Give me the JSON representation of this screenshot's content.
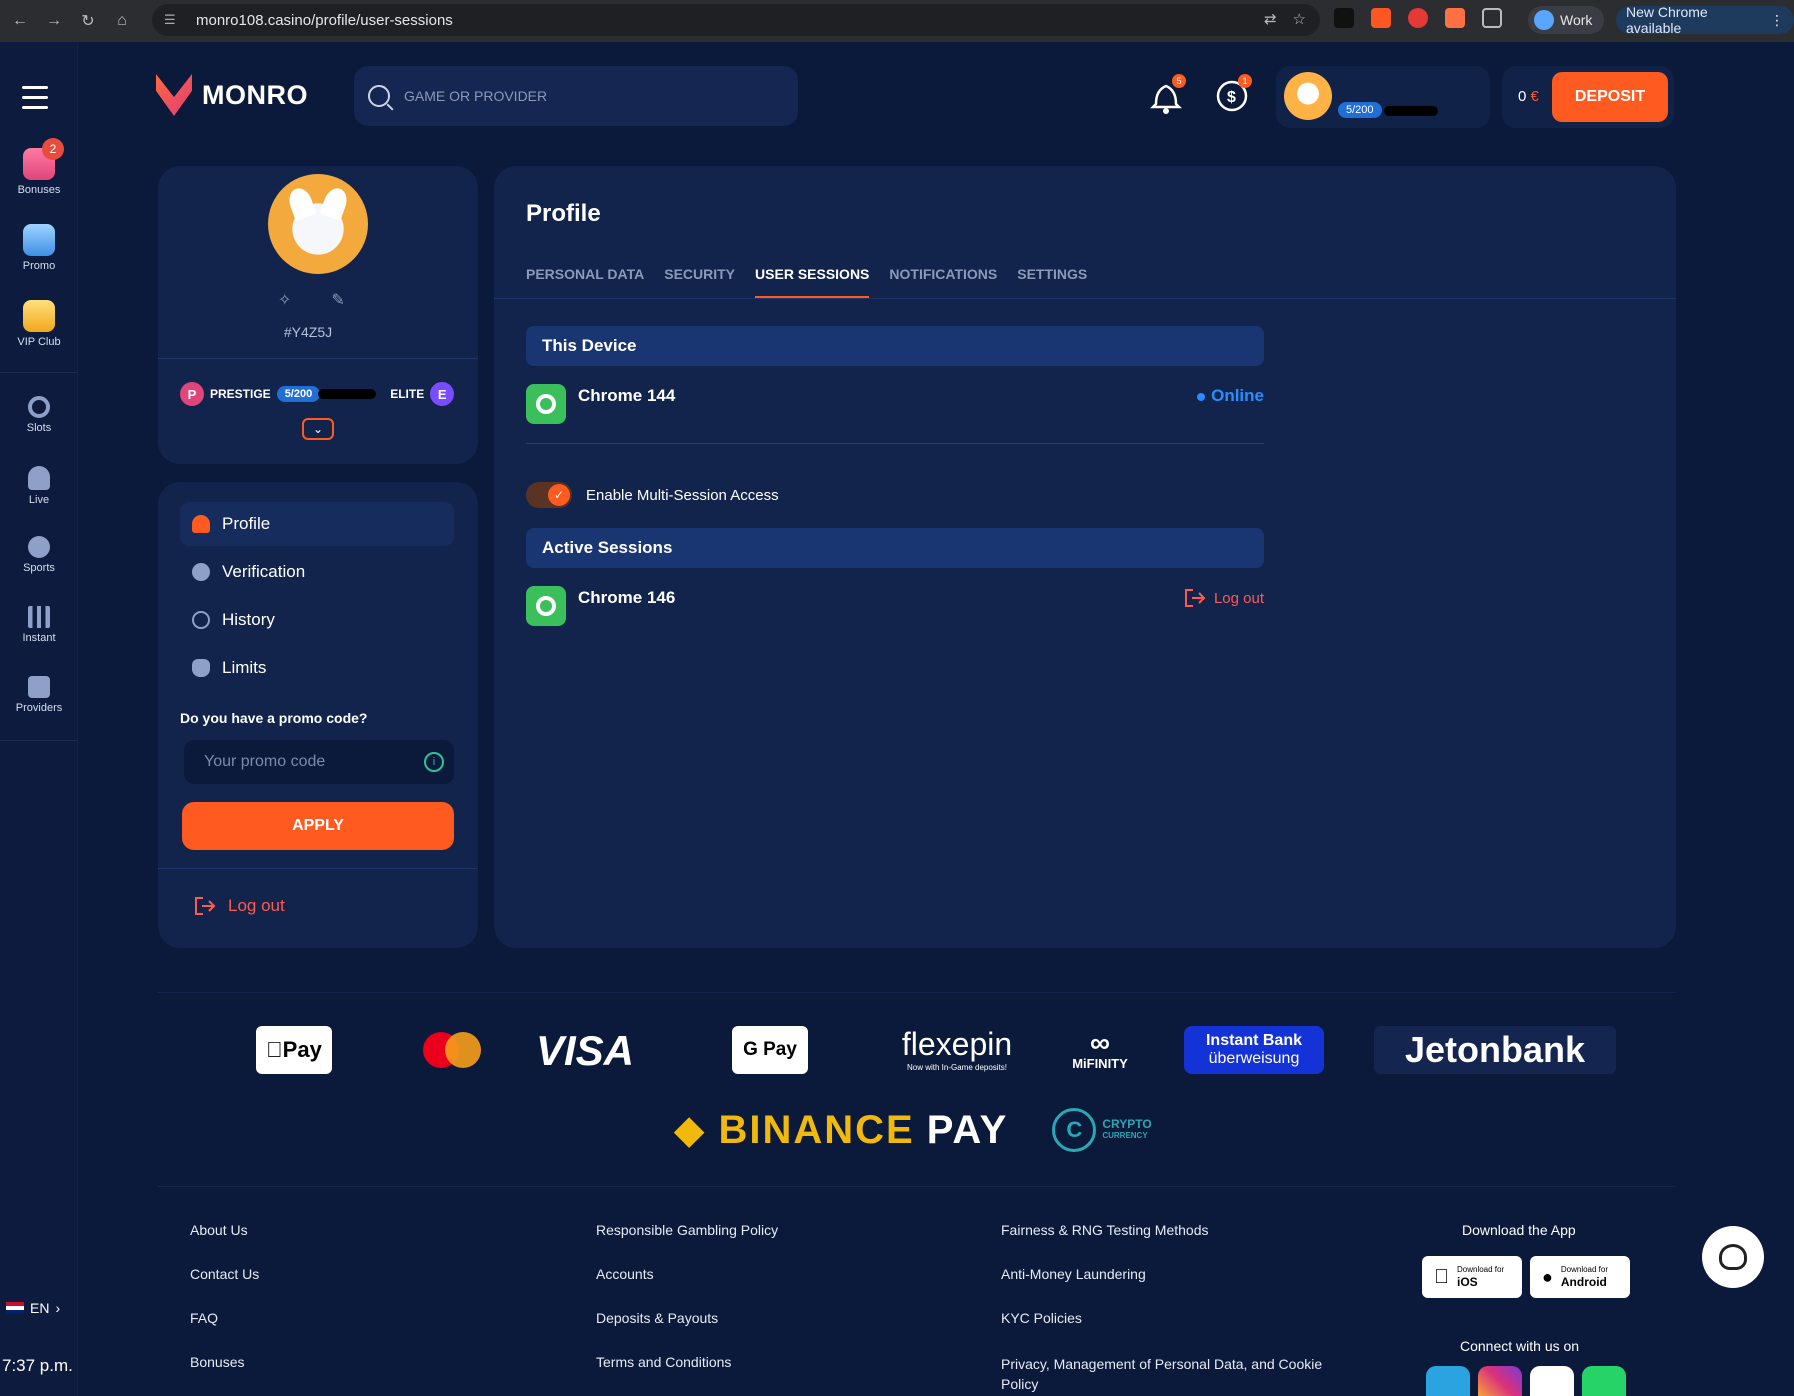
{
  "browser": {
    "url": "monro108.casino/profile/user-sessions",
    "profile_name": "Work",
    "update_label": "New Chrome available"
  },
  "rail": {
    "items": [
      {
        "label": "Bonuses",
        "badge": "2"
      },
      {
        "label": "Promo"
      },
      {
        "label": "VIP Club"
      },
      {
        "label": "Slots"
      },
      {
        "label": "Live"
      },
      {
        "label": "Sports"
      },
      {
        "label": "Instant"
      },
      {
        "label": "Providers"
      }
    ],
    "language": "EN",
    "clock": "7:37 p.m."
  },
  "header": {
    "brand": "MONRO",
    "search_placeholder": "GAME OR PROVIDER",
    "notif_count": "5",
    "cashback_count": "1",
    "level": "5/200",
    "balance_value": "0",
    "balance_currency": "€",
    "deposit_label": "DEPOSIT"
  },
  "profile_card": {
    "user_id": "#Y4Z5J",
    "current_tier_letter": "P",
    "current_tier": "PRESTIGE",
    "progress": "5/200",
    "next_tier": "ELITE",
    "next_tier_letter": "E"
  },
  "menu": {
    "items": [
      {
        "label": "Profile"
      },
      {
        "label": "Verification"
      },
      {
        "label": "History"
      },
      {
        "label": "Limits"
      }
    ],
    "promo_label": "Do you have a promo code?",
    "promo_placeholder": "Your promo code",
    "apply_label": "APPLY",
    "logout_label": "Log out"
  },
  "main": {
    "title": "Profile",
    "tabs": [
      {
        "label": "PERSONAL DATA"
      },
      {
        "label": "SECURITY"
      },
      {
        "label": "USER SESSIONS"
      },
      {
        "label": "NOTIFICATIONS"
      },
      {
        "label": "SETTINGS"
      }
    ],
    "active_tab": "USER SESSIONS",
    "this_device_title": "This Device",
    "this_device": {
      "name": "Chrome 144",
      "status": "Online"
    },
    "multi_session_label": "Enable Multi-Session Access",
    "multi_session_enabled": true,
    "active_sessions_title": "Active Sessions",
    "active_sessions": [
      {
        "name": "Chrome 146",
        "action": "Log out"
      }
    ]
  },
  "payments": {
    "applepay": "Pay",
    "visa": "VISA",
    "gpay": "G Pay",
    "flexepin": "flexepin",
    "flexepin_tag": "Now with In-Game deposits!",
    "mifinity": "MiFINITY",
    "instantbank_1": "Instant Bank",
    "instantbank_2": "überweisung",
    "jetonbank": "Jetonbank",
    "binance": "BINANCE",
    "binance_pay": "PAY",
    "crypto_1": "CRYPTO",
    "crypto_2": "CURRENCY"
  },
  "footer": {
    "col1": [
      "About Us",
      "Contact Us",
      "FAQ",
      "Bonuses"
    ],
    "col2": [
      "Responsible Gambling Policy",
      "Accounts",
      "Deposits & Payouts",
      "Terms and Conditions"
    ],
    "col3": [
      "Fairness & RNG Testing Methods",
      "Anti-Money Laundering",
      "KYC Policies",
      "Privacy, Management of Personal Data, and Cookie Policy"
    ],
    "download_title": "Download the App",
    "ios_small": "Download for",
    "ios_label": "iOS",
    "android_small": "Download for",
    "android_label": "Android",
    "connect_title": "Connect with us on"
  },
  "colors": {
    "accent": "#ff5a1f",
    "background": "#0b1a3a",
    "card": "#12244c",
    "online": "#2b8cff",
    "logout": "#ff5a4f"
  }
}
